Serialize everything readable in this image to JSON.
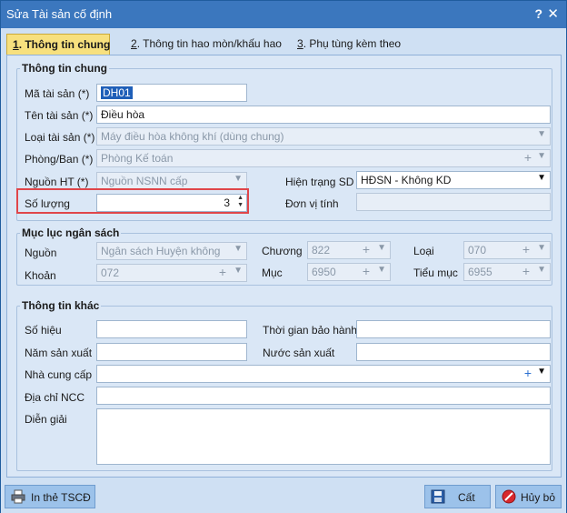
{
  "window": {
    "title": "Sửa Tài sản cố định",
    "help_glyph": "?",
    "close_glyph": "✕"
  },
  "tabs": [
    {
      "key": "1",
      "label": ". Thông tin chung",
      "active": true
    },
    {
      "key": "2",
      "label": ". Thông tin hao mòn/khấu hao",
      "active": false
    },
    {
      "key": "3",
      "label": ". Phụ tùng kèm theo",
      "active": false
    }
  ],
  "general": {
    "group_title": "Thông tin chung",
    "ma_tai_san": {
      "label": "Mã tài sản (*)",
      "value": "DH01"
    },
    "ten_tai_san": {
      "label": "Tên tài sản (*)",
      "value": "Điều hòa"
    },
    "loai_tai_san": {
      "label": "Loại tài sản (*)",
      "value": "Máy điều hòa không khí (dùng chung)"
    },
    "phong_ban": {
      "label": "Phòng/Ban (*)",
      "value": "Phòng Kế toán"
    },
    "nguon_ht": {
      "label": "Nguồn HT (*)",
      "value": "Nguồn NSNN cấp"
    },
    "hien_trang": {
      "label": "Hiện trạng SD",
      "value": "HĐSN - Không KD"
    },
    "so_luong": {
      "label": "Số lượng",
      "value": "3"
    },
    "don_vi_tinh": {
      "label": "Đơn vị tính",
      "value": ""
    }
  },
  "budget": {
    "group_title": "Mục lục ngân sách",
    "nguon": {
      "label": "Nguồn",
      "value": "Ngân sách Huyện không"
    },
    "chuong": {
      "label": "Chương",
      "value": "822"
    },
    "loai": {
      "label": "Loại",
      "value": "070"
    },
    "khoan": {
      "label": "Khoản",
      "value": "072"
    },
    "muc": {
      "label": "Mục",
      "value": "6950"
    },
    "tieu_muc": {
      "label": "Tiểu mục",
      "value": "6955"
    }
  },
  "other": {
    "group_title": "Thông tin khác",
    "so_hieu": {
      "label": "Số hiệu",
      "value": ""
    },
    "thoi_gian_bao_hanh": {
      "label": "Thời gian bảo hành",
      "value": ""
    },
    "nam_san_xuat": {
      "label": "Năm sản xuất",
      "value": ""
    },
    "nuoc_san_xuat": {
      "label": "Nước sản xuất",
      "value": ""
    },
    "nha_cung_cap": {
      "label": "Nhà cung cấp",
      "value": ""
    },
    "dia_chi_ncc": {
      "label": "Địa chỉ NCC",
      "value": ""
    },
    "dien_giai": {
      "label": "Diễn giải",
      "value": ""
    }
  },
  "buttons": {
    "print": "In thẻ TSCĐ",
    "save": "Cất",
    "cancel": "Hủy bỏ"
  },
  "glyphs": {
    "dropdown": "▼",
    "plus": "+",
    "spin_up": "▲",
    "spin_down": "▼"
  },
  "colors": {
    "titlebar": "#3b77be",
    "active_tab": "#f7e07e",
    "highlight": "#e0464a",
    "button": "#9cc2ea"
  }
}
